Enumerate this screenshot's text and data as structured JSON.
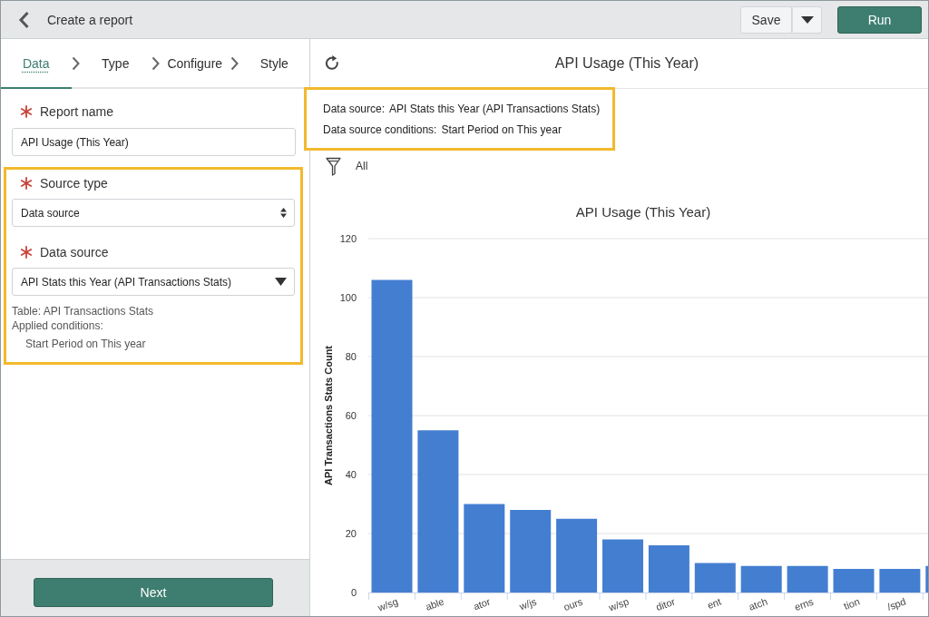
{
  "header": {
    "title": "Create a report",
    "buttons": [
      {
        "kind": "split",
        "label": "Save"
      },
      {
        "kind": "primary",
        "label": "Run"
      }
    ]
  },
  "steps": [
    {
      "label": "Data",
      "selected": true
    },
    {
      "label": "Type",
      "selected": false
    },
    {
      "label": "Configure",
      "selected": false
    },
    {
      "label": "Style",
      "selected": false
    }
  ],
  "form": {
    "report_name": {
      "label": "Report name",
      "required": true,
      "value": "API Usage (This Year)"
    },
    "source_group": {
      "highlighted": true,
      "fields": [
        {
          "kind": "select",
          "label": "Source type",
          "required": true,
          "value": "Data source"
        },
        {
          "kind": "dropdown",
          "label": "Data source",
          "required": true,
          "value": "API Stats this Year (API Transactions Stats)"
        }
      ],
      "table_note": "Table: API Transactions Stats",
      "conditions_heading": "Applied conditions:",
      "conditions": [
        "Start Period on This year"
      ]
    },
    "next_button": "Next"
  },
  "report": {
    "title": "API Usage (This Year)",
    "info": {
      "highlighted": true,
      "lines": [
        {
          "label": "Data source:",
          "value": "API Stats this Year (API Transactions Stats)"
        },
        {
          "label": "Data source conditions:",
          "value": "Start Period on This year"
        }
      ]
    },
    "filter": "All",
    "chart_data": {
      "type": "bar",
      "title": "API Usage (This Year)",
      "ylabel": "API Transactions Stats Count",
      "categories": [
        "w/sg",
        "able",
        "ator",
        "w/js",
        "ours",
        "w/sp",
        "ditor",
        "ent",
        "atch",
        "erns",
        "tion",
        "/spd",
        null
      ],
      "values": [
        106,
        55,
        30,
        28,
        25,
        18,
        16,
        10,
        9,
        9,
        8,
        8,
        9
      ],
      "ylim": [
        0,
        120
      ],
      "yticks": [
        0,
        20,
        40,
        60,
        80,
        100,
        120
      ],
      "grid": true
    }
  }
}
